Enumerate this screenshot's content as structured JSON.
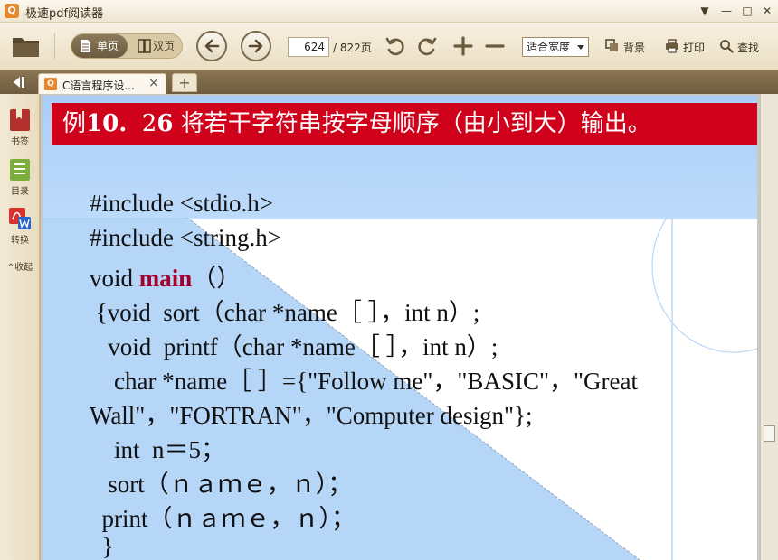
{
  "window": {
    "title": "极速pdf阅读器",
    "logo_glyph": "Q",
    "controls": [
      "▼",
      "—",
      "□",
      "✕"
    ]
  },
  "toolbar": {
    "open_icon": "folder-icon",
    "view_single_label": "单页",
    "view_double_label": "双页",
    "current_page": "624",
    "total_pages": "/ 822页",
    "zoom_value": "适合宽度",
    "background_label": "背景",
    "print_label": "打印",
    "find_label": "查找"
  },
  "tabs": {
    "active_label": "C语言程序设...",
    "close_glyph": "×",
    "add_glyph": "+"
  },
  "sidebar": {
    "bookmark_label": "书签",
    "toc_label": "目录",
    "convert_label": "转换",
    "collapse_label": "^收起"
  },
  "document": {
    "banner_prefix": "例",
    "banner_num": "10.",
    "banner_num2": "2",
    "banner_num3": "6",
    "banner_text": "将若干字符串按字母顺序（由小到大）输出。",
    "code_lines": [
      "#include <stdio.h>",
      "#include <string.h>",
      "void ",
      "main",
      "（）",
      " {void  sort（char *name［ ］，int n）;",
      "   void  printf（char *name［ ］，int n）;",
      "    char *name［ ］={\"Follow me\"，\"BASIC\"，\"Great",
      "Wall\"，\"FORTRAN\"，\"Computer design\"};",
      "    int  n＝5；",
      "   sort（ｎａｍｅ，ｎ）；",
      "  print（ｎａｍｅ，ｎ）；",
      "  }"
    ]
  },
  "colors": {
    "banner_red": "#d0021b",
    "keyword_red": "#a3002a",
    "accent_orange": "#e7862a"
  }
}
